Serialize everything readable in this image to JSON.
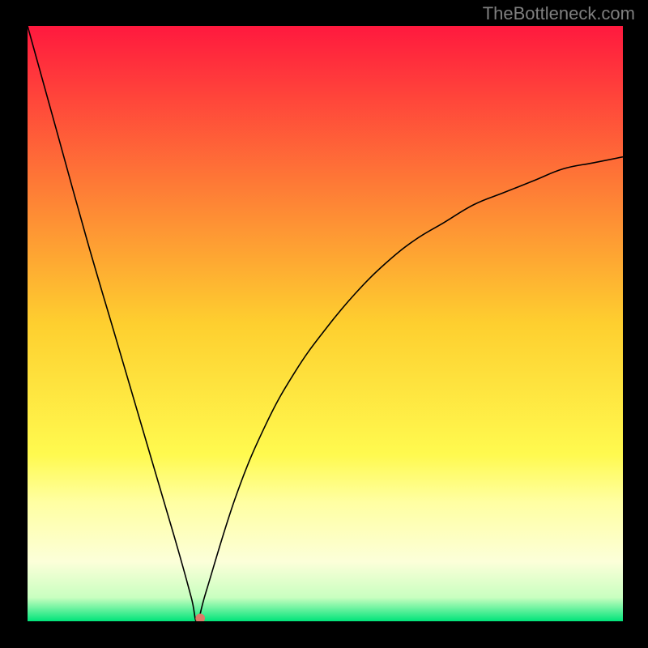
{
  "attribution": "TheBottleneck.com",
  "accent_dot_color": "#dd7b69",
  "chart_data": {
    "type": "line",
    "title": "",
    "xlabel": "",
    "ylabel": "",
    "xlim": [
      0,
      100
    ],
    "ylim": [
      0,
      100
    ],
    "series": [
      {
        "name": "bottleneck-curve",
        "x": [
          0,
          5,
          10,
          15,
          20,
          25,
          27.5,
          28.5,
          30,
          35,
          40,
          45,
          50,
          55,
          60,
          65,
          70,
          75,
          80,
          85,
          90,
          95,
          100
        ],
        "values": [
          100,
          82,
          64,
          47,
          30,
          13,
          4,
          0,
          5,
          21,
          33,
          42,
          49,
          55,
          60,
          64,
          67,
          70,
          72,
          74,
          76,
          77,
          78
        ]
      }
    ],
    "annotations": [
      {
        "name": "optimum-dot",
        "x": 29,
        "y": 0.5
      }
    ],
    "background": {
      "type": "vertical-gradient",
      "stops": [
        {
          "at": 0,
          "color": "#ff193e"
        },
        {
          "at": 0.5,
          "color": "#fecf2f"
        },
        {
          "at": 0.72,
          "color": "#fffa4f"
        },
        {
          "at": 0.8,
          "color": "#ffffa2"
        },
        {
          "at": 0.9,
          "color": "#fcffd9"
        },
        {
          "at": 0.96,
          "color": "#c9ffc0"
        },
        {
          "at": 1.0,
          "color": "#00e47a"
        }
      ]
    }
  }
}
